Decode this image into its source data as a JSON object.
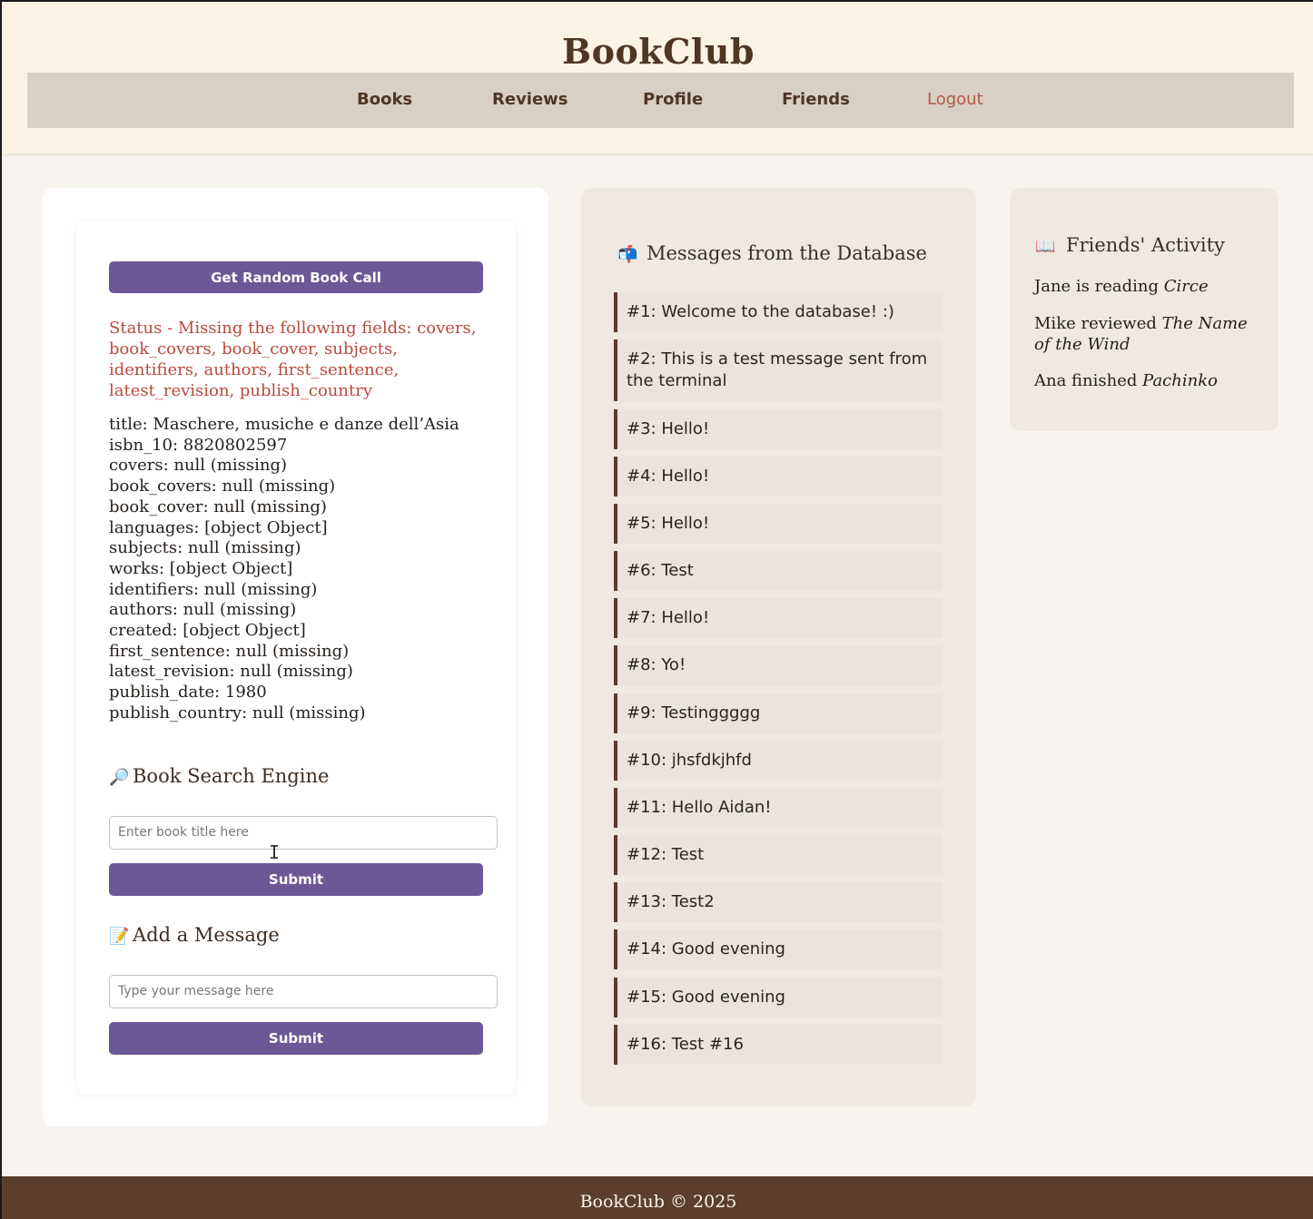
{
  "header": {
    "title": "BookClub",
    "nav": [
      {
        "label": "Books"
      },
      {
        "label": "Reviews"
      },
      {
        "label": "Profile"
      },
      {
        "label": "Friends"
      },
      {
        "label": "Logout"
      }
    ]
  },
  "random_book": {
    "button_label": "Get Random Book Call",
    "status": "Status - Missing the following fields: covers, book_covers, book_cover, subjects, identifiers, authors, first_sentence, latest_revision, publish_country",
    "fields": [
      "title: Maschere, musiche e danze dell’Asia",
      "isbn_10: 8820802597",
      "covers: null (missing)",
      "book_covers: null (missing)",
      "book_cover: null (missing)",
      "languages: [object Object]",
      "subjects: null (missing)",
      "works: [object Object]",
      "identifiers: null (missing)",
      "authors: null (missing)",
      "created: [object Object]",
      "first_sentence: null (missing)",
      "latest_revision: null (missing)",
      "publish_date: 1980",
      "publish_country: null (missing)"
    ]
  },
  "search": {
    "heading": "Book Search Engine",
    "icon": "magnifier-icon",
    "placeholder": "Enter book title here",
    "submit_label": "Submit"
  },
  "add_message": {
    "heading": "Add a Message",
    "icon": "memo-icon",
    "placeholder": "Type your message here",
    "submit_label": "Submit"
  },
  "messages": {
    "heading": "Messages from the Database",
    "icon": "mailbox-icon",
    "items": [
      "#1: Welcome to the database! :)",
      "#2: This is a test message sent from the terminal",
      "#3: Hello!",
      "#4: Hello!",
      "#5: Hello!",
      "#6: Test",
      "#7: Hello!",
      "#8: Yo!",
      "#9: Testinggggg",
      "#10: jhsfdkjhfd",
      "#11: Hello Aidan!",
      "#12: Test",
      "#13: Test2",
      "#14: Good evening",
      "#15: Good evening",
      "#16: Test #16"
    ]
  },
  "friends": {
    "heading": "Friends' Activity",
    "icon": "open-book-icon",
    "items": [
      {
        "text": "Jane is reading ",
        "book": "Circe"
      },
      {
        "text": "Mike reviewed ",
        "book": "The Name of the Wind"
      },
      {
        "text": "Ana finished ",
        "book": "Pachinko"
      }
    ]
  },
  "footer": {
    "text": "BookClub © 2025"
  },
  "colors": {
    "header_bg": "#fdf3e4",
    "nav_bg": "#d9cfc3",
    "brand_brown": "#4f3623",
    "button_purple": "#6c5897",
    "status_red": "#b84a3c",
    "footer_bg": "#5b3f2c"
  }
}
